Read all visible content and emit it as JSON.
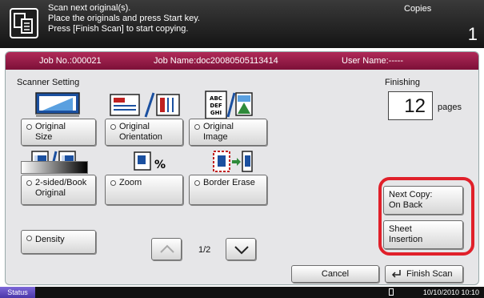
{
  "header": {
    "message_lines": [
      "Scan next original(s).",
      "Place the originals and press Start key.",
      "Press [Finish Scan] to start copying."
    ],
    "mode": "Copies",
    "count": "1"
  },
  "job": {
    "job_no": "Job No.:000021",
    "job_name": "Job Name:doc20080505113414",
    "user_name": "User Name:-----"
  },
  "scanner": {
    "title": "Scanner Setting",
    "buttons": {
      "original_size": [
        "Original",
        "Size"
      ],
      "original_orientation": [
        "Original",
        "Orientation"
      ],
      "original_image": [
        "Original",
        "Image"
      ],
      "two_sided": [
        "2-sided/Book",
        "Original"
      ],
      "zoom": "Zoom",
      "border_erase": "Border Erase",
      "density": "Density"
    },
    "page_indicator": "1/2"
  },
  "finishing": {
    "title": "Finishing",
    "pages_value": "12",
    "pages_unit": "pages",
    "next_copy": [
      "Next Copy:",
      "On Back"
    ],
    "sheet_insertion": [
      "Sheet",
      "Insertion"
    ]
  },
  "actions": {
    "cancel": "Cancel",
    "finish_scan": "Finish Scan"
  },
  "statusbar": {
    "status": "Status",
    "datetime": "10/10/2010  10:10"
  },
  "colors": {
    "job_bar": "#9a1c48",
    "highlight": "#e0202a",
    "status_button": "#5a46b8"
  },
  "icons": [
    "document-copy-icon",
    "original-size-icon",
    "orientation-icon",
    "image-type-icon",
    "two-sided-icon",
    "zoom-icon",
    "border-erase-icon",
    "arrow-up-icon",
    "arrow-down-icon",
    "finish-scan-enter-icon",
    "sd-card-icon"
  ]
}
